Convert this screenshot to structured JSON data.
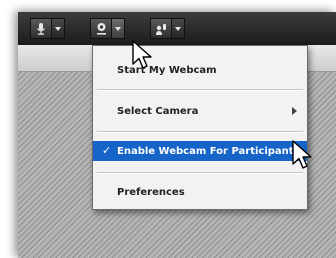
{
  "toolbar": {
    "buttons": [
      {
        "name": "microphone",
        "icon": "microphone-icon"
      },
      {
        "name": "webcam",
        "icon": "webcam-icon"
      },
      {
        "name": "presenter",
        "icon": "raise-hand-icon"
      }
    ]
  },
  "menu": {
    "items": [
      {
        "label": "Start My Webcam",
        "checked": false,
        "submenu": false
      },
      {
        "label": "Select Camera",
        "checked": false,
        "submenu": true
      },
      {
        "label": "Enable Webcam For Participants",
        "checked": true,
        "submenu": false,
        "highlighted": true
      },
      {
        "label": "Preferences",
        "checked": false,
        "submenu": false
      }
    ],
    "check_mark": "✓"
  },
  "colors": {
    "toolbar": "#2a2a2a",
    "menu_highlight": "#1664c7",
    "menu_background": "#f2f2f2"
  }
}
